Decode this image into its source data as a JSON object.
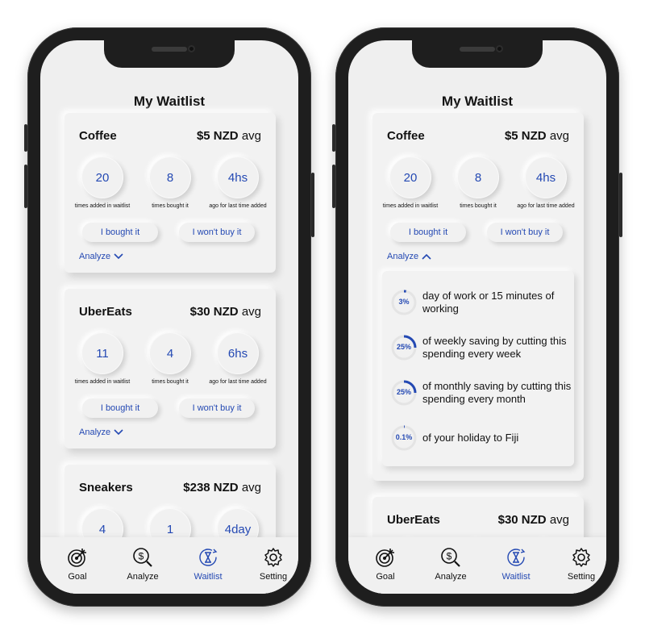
{
  "screen_title": "My Waitlist",
  "stat_captions": {
    "added": "times added in waitlist",
    "bought": "times bought it",
    "last": "ago for last time added"
  },
  "buttons": {
    "bought": "I bought it",
    "wont_buy": "I won't buy it"
  },
  "analyze_label": "Analyze",
  "price_unit": "avg",
  "items": [
    {
      "name": "Coffee",
      "price": "$5 NZD",
      "added": "20",
      "bought": "8",
      "last": "4hs"
    },
    {
      "name": "UberEats",
      "price": "$30 NZD",
      "added": "11",
      "bought": "4",
      "last": "6hs"
    },
    {
      "name": "Sneakers",
      "price": "$238 NZD",
      "added": "4",
      "bought": "1",
      "last": "4day"
    }
  ],
  "analysis": [
    {
      "percent": "3%",
      "fraction": 0.03,
      "text": "day of work or 15 minutes of working"
    },
    {
      "percent": "25%",
      "fraction": 0.25,
      "text": "of weekly saving by cutting this spending every week"
    },
    {
      "percent": "25%",
      "fraction": 0.25,
      "text": "of monthly saving by cutting this spending every month"
    },
    {
      "percent": "0.1%",
      "fraction": 0.01,
      "text": "of your holiday to Fiji"
    }
  ],
  "tabs": [
    {
      "label": "Goal",
      "icon": "target-icon"
    },
    {
      "label": "Analyze",
      "icon": "dollar-search-icon"
    },
    {
      "label": "Waitlist",
      "icon": "hourglass-icon",
      "active": true
    },
    {
      "label": "Setting",
      "icon": "gear-icon"
    }
  ],
  "colors": {
    "accent": "#2449b3",
    "background": "#efefef",
    "frame": "#1e1e1e"
  }
}
